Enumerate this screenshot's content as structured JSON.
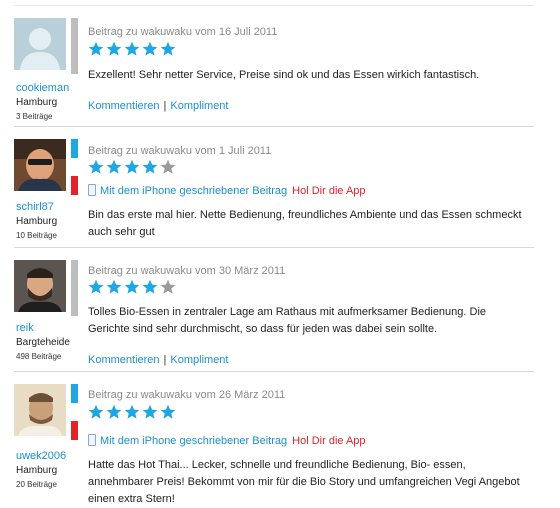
{
  "colors": {
    "accent": "#1fa7e1",
    "link": "#1a8fd0",
    "app_link": "#e0242a",
    "star_filled": "#1fa7e1",
    "star_empty": "#9a9a9a"
  },
  "reviews": [
    {
      "username": "cookieman",
      "city": "Hamburg",
      "count": "3 Beiträge",
      "meta": "Beitrag zu wakuwaku vom 16 Juli 2011",
      "rating": 5,
      "text": "Exzellent! Sehr netter Service, Preise sind ok und das Essen wirkich fantastisch.",
      "actions": {
        "comment": "Kommentieren",
        "separator": "|",
        "compliment": "Kompliment"
      }
    },
    {
      "username": "schirl87",
      "city": "Hamburg",
      "count": "10 Beiträge",
      "meta": "Beitrag zu wakuwaku vom 1 Juli 2011",
      "rating": 4,
      "iphone": {
        "text": "Mit dem iPhone geschriebener Beitrag",
        "app": "Hol Dir die App"
      },
      "text": "Bin das erste mal hier. Nette Bedienung, freundliches Ambiente und das Essen schmeckt auch sehr gut"
    },
    {
      "username": "reik",
      "city": "Bargteheide",
      "count": "498 Beiträge",
      "meta": "Beitrag zu wakuwaku vom 30 März 2011",
      "rating": 4,
      "text": "Tolles Bio-Essen in zentraler Lage am Rathaus mit aufmerksamer Bedienung. Die Gerichte sind sehr durchmischt, so dass für jeden was dabei sein sollte.",
      "actions": {
        "comment": "Kommentieren",
        "separator": "|",
        "compliment": "Kompliment"
      }
    },
    {
      "username": "uwek2006",
      "city": "Hamburg",
      "count": "20 Beiträge",
      "meta": "Beitrag zu wakuwaku vom 26 März 2011",
      "rating": 5,
      "iphone": {
        "text": "Mit dem iPhone geschriebener Beitrag",
        "app": "Hol Dir die App"
      },
      "text": "Hatte das Hot Thai... Lecker, schnelle und freundliche Bedienung, Bio- essen, annehmbarer Preis! Bekommt von mir für die Bio Story und umfangreichen Vegi Angebot einen extra Stern!"
    }
  ]
}
